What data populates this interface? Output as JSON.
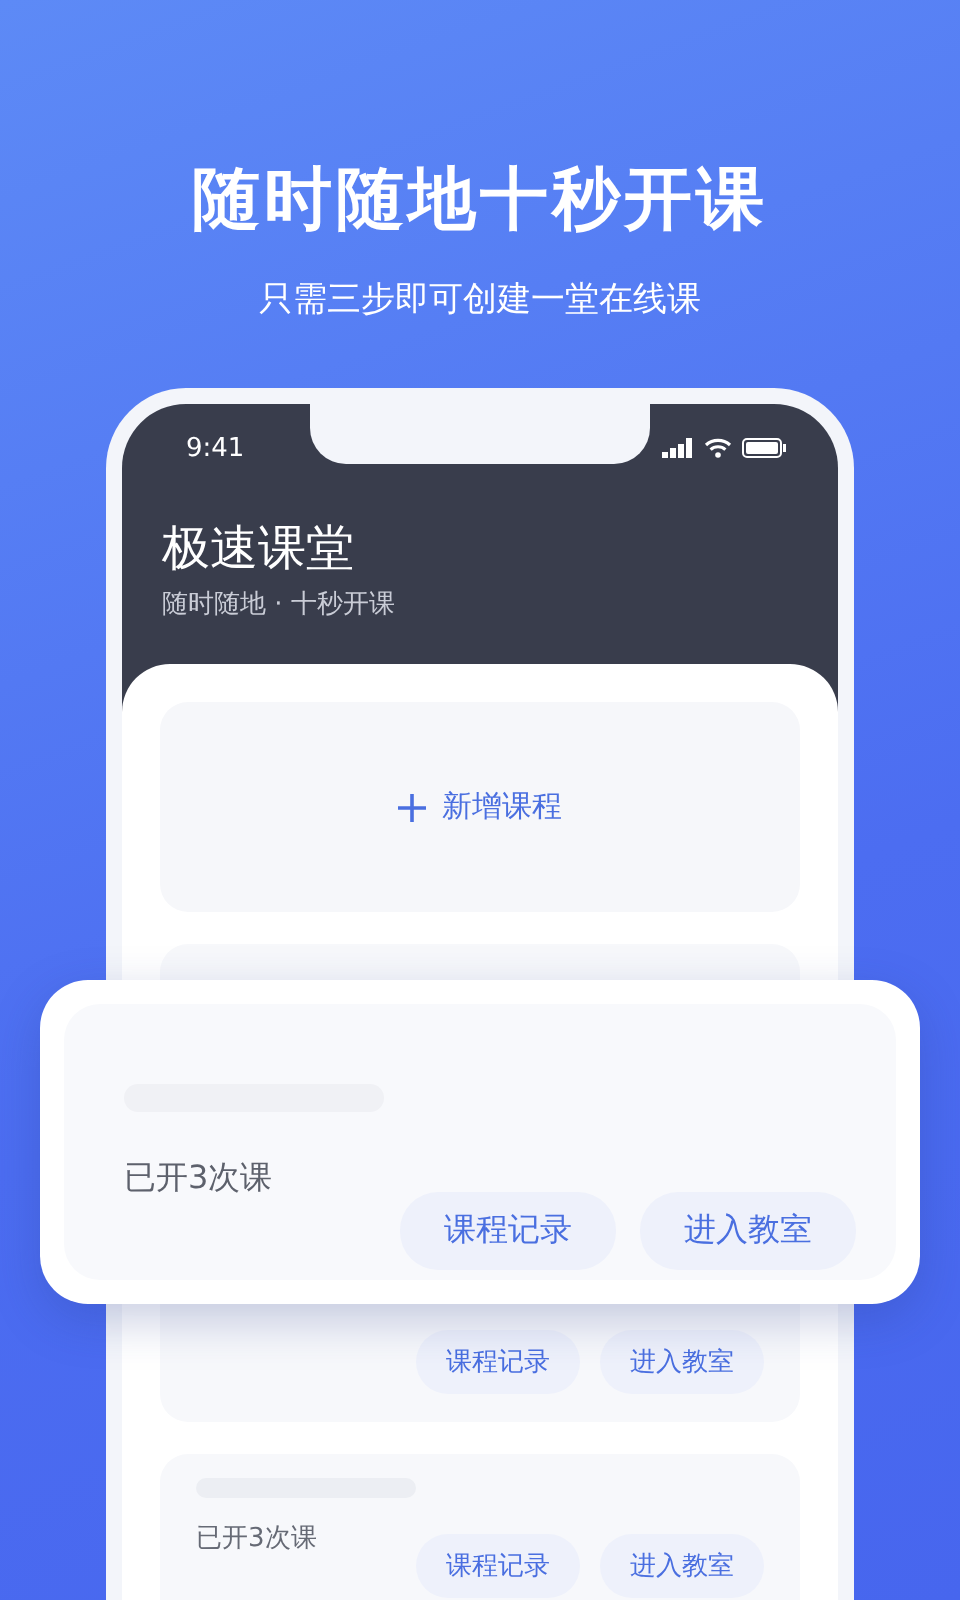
{
  "headline": "随时随地十秒开课",
  "subheadline": "只需三步即可创建一堂在线课",
  "phone": {
    "status_bar": {
      "time": "9:41"
    },
    "app_title": "极速课堂",
    "app_subtitle": "随时随地 · 十秒开课",
    "add_course": {
      "label": "新增课程"
    },
    "courses": [
      {
        "buttons": [
          "课程记录",
          "进入教室"
        ]
      },
      {
        "caption": "已开3次课",
        "buttons": [
          "课程记录",
          "进入教室"
        ]
      }
    ]
  },
  "highlight_card": {
    "caption": "已开3次课",
    "buttons": [
      "课程记录",
      "进入教室"
    ]
  }
}
